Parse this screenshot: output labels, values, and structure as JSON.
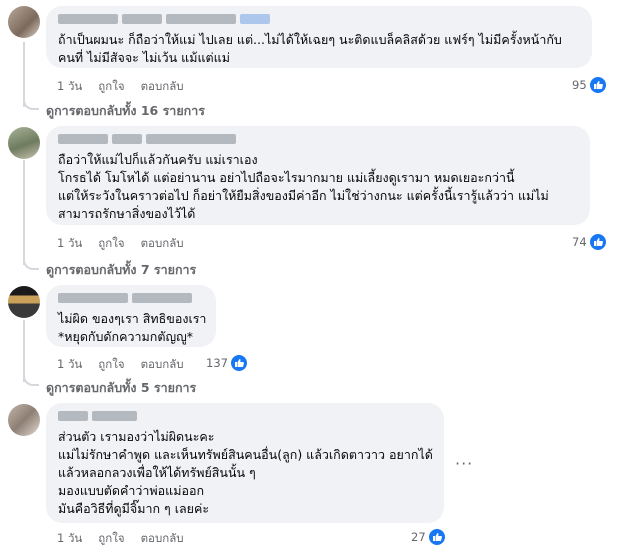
{
  "comments": [
    {
      "name": "",
      "lines": [
        "ถ้าเป็นผมนะ ก็ถือว่าให้แม่ ไปเลย แต่...ไม่ได้ให้เฉยๆ นะติดแบล็คลิสด้วย แฟร์ๆ ไม่มีครั้งหน้ากับ",
        "คนที่ ไม่มีสัจจะ ไม่เว้น แม้แต่แม่"
      ],
      "time": "1 วัน",
      "like": "ถูกใจ",
      "reply": "ตอบกลับ",
      "reactions": "95",
      "view_replies": "ดูการตอบกลับทั้ง 16 รายการ"
    },
    {
      "name": "",
      "lines": [
        "ถือว่าให้แม่ไปก็แล้วกันครับ แม่เราเอง",
        "โกรธได้ โมโหได้ แต่อย่านาน อย่าไปถือจะไรมากมาย แม่เลี้ยงดูเรามา หมดเยอะกว่านี้",
        "แต่ให้ระวังในคราวต่อไป ก็อย่าให้ยืมสิ่งของมีค่าอีก ไม่ใช่ว่างกนะ แต่ครั้งนี้เรารู้แล้วว่า แม่ไม่",
        "สามารถรักษาสิ่งของไว้ได้"
      ],
      "time": "1 วัน",
      "like": "ถูกใจ",
      "reply": "ตอบกลับ",
      "reactions": "74",
      "view_replies": "ดูการตอบกลับทั้ง 7 รายการ"
    },
    {
      "name": "",
      "lines": [
        "ไม่ผิด ของๆเรา สิทธิของเรา",
        "*หยุดกับดักความกตัญญู*"
      ],
      "time": "1 วัน",
      "like": "ถูกใจ",
      "reply": "ตอบกลับ",
      "reactions": "137",
      "view_replies": "ดูการตอบกลับทั้ง 5 รายการ"
    },
    {
      "name": "",
      "lines": [
        "ส่วนตัว เรามองว่าไม่ผิดนะคะ",
        "แม่ไม่รักษาคำพูด และเห็นทรัพย์สินคนอื่น(ลูก) แล้วเกิดตาวาว อยากได้",
        "แล้วหลอกลวงเพื่อให้ได้ทรัพย์สินนั้น ๆ",
        "มองแบบตัดคำว่าพ่อแม่ออก",
        "มันคือวิธีที่ดูมีจิ๊มาก ๆ เลยค่ะ"
      ],
      "time": "1 วัน",
      "like": "ถูกใจ",
      "reply": "ตอบกลับ",
      "reactions": "27",
      "more_menu": "···"
    }
  ],
  "colors": {
    "like_blue": "#1877f2",
    "bubble": "#f0f2f5",
    "meta_text": "#65676b"
  },
  "icons": {
    "reaction": "thumbs-up-icon",
    "more": "more-options-icon"
  }
}
